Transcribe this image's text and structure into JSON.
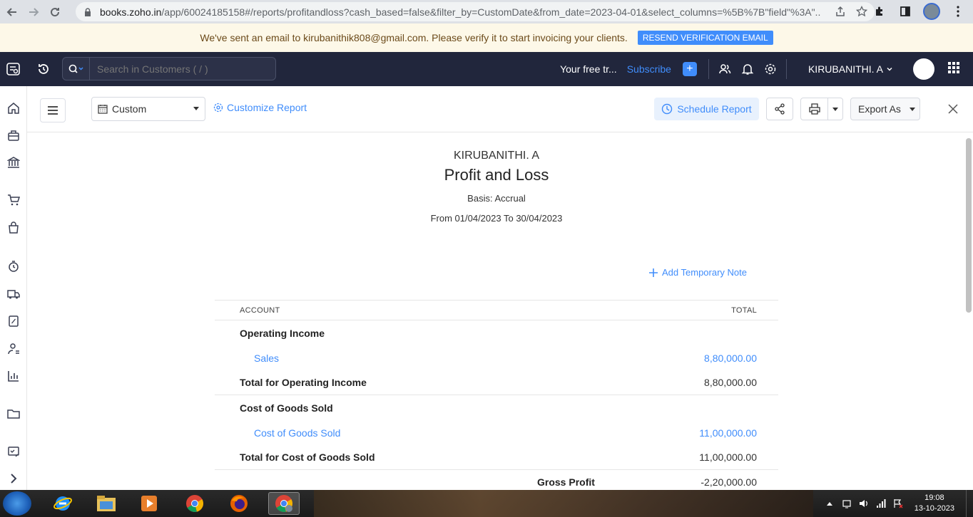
{
  "browser": {
    "url_host": "books.zoho.in",
    "url_path": "/app/60024185158#/reports/profitandloss?cash_based=false&filter_by=CustomDate&from_date=2023-04-01&select_columns=%5B%7B\"field\"%3A\"..."
  },
  "banner": {
    "message": "We've sent an email to kirubanithik808@gmail.com. Please verify it to start invoicing your clients.",
    "button": "RESEND VERIFICATION EMAIL"
  },
  "topbar": {
    "search_placeholder": "Search in Customers ( / )",
    "trial_text": "Your free tr...",
    "subscribe": "Subscribe",
    "org_name": "KIRUBANITHI. A"
  },
  "toolbar": {
    "date_filter": "Custom",
    "customize": "Customize Report",
    "schedule": "Schedule Report",
    "export": "Export As"
  },
  "report": {
    "org": "KIRUBANITHI. A",
    "title": "Profit and Loss",
    "basis": "Basis: Accrual",
    "range": "From 01/04/2023 To 30/04/2023",
    "temp_note": "Add Temporary Note",
    "columns": {
      "account": "ACCOUNT",
      "total": "TOTAL"
    },
    "operating_income": {
      "heading": "Operating Income",
      "item_label": "Sales",
      "item_value": "8,80,000.00",
      "total_label": "Total for Operating Income",
      "total_value": "8,80,000.00"
    },
    "cogs": {
      "heading": "Cost of Goods Sold",
      "item_label": "Cost of Goods Sold",
      "item_value": "11,00,000.00",
      "total_label": "Total for Cost of Goods Sold",
      "total_value": "11,00,000.00"
    },
    "gross_profit": {
      "label": "Gross Profit",
      "value": "-2,20,000.00"
    }
  },
  "taskbar": {
    "time": "19:08",
    "date": "13-10-2023"
  },
  "colors": {
    "accent": "#408dfb",
    "topbar": "#21263c",
    "banner": "#fdf8e8"
  }
}
